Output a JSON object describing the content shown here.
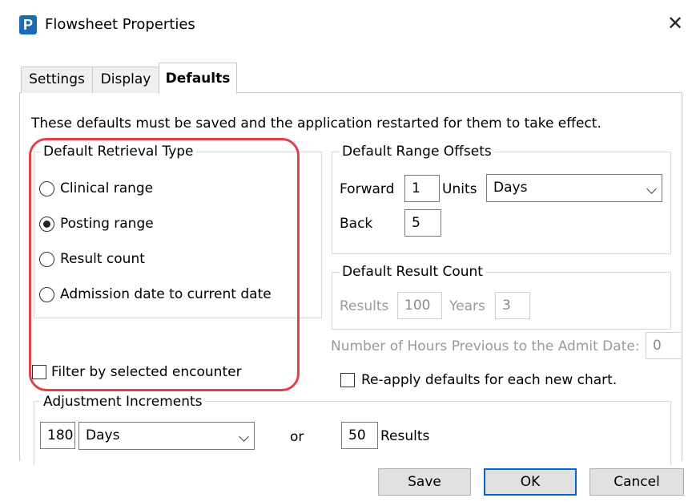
{
  "window": {
    "app_icon_letter": "P",
    "title": "Flowsheet Properties",
    "close_glyph": "✕"
  },
  "tabs": [
    {
      "label": "Settings",
      "active": false
    },
    {
      "label": "Display",
      "active": false
    },
    {
      "label": "Defaults",
      "active": true
    }
  ],
  "notice": "These defaults must be saved and the application restarted for them to take effect.",
  "retrieval": {
    "legend": "Default Retrieval Type",
    "options": [
      {
        "label": "Clinical range",
        "selected": false
      },
      {
        "label": "Posting range",
        "selected": true
      },
      {
        "label": "Result count",
        "selected": false
      },
      {
        "label": "Admission date to current date",
        "selected": false
      }
    ]
  },
  "filter_encounter": {
    "label": "Filter by selected encounter",
    "checked": false
  },
  "range_offsets": {
    "legend": "Default Range Offsets",
    "forward_label": "Forward",
    "forward_value": "1",
    "units_label": "Units",
    "units_value": "Days",
    "back_label": "Back",
    "back_value": "5"
  },
  "result_count": {
    "legend": "Default Result Count",
    "results_label": "Results",
    "results_value": "100",
    "years_label": "Years",
    "years_value": "3"
  },
  "hours_previous": {
    "label": "Number of Hours Previous to the Admit Date:",
    "value": "0"
  },
  "reapply": {
    "label": "Re-apply defaults for each new chart.",
    "checked": false
  },
  "adjustment": {
    "legend": "Adjustment Increments",
    "days_value": "180",
    "days_unit": "Days",
    "or_label": "or",
    "results_value": "50",
    "results_label": "Results"
  },
  "buttons": {
    "save": "Save",
    "ok": "OK",
    "cancel": "Cancel"
  },
  "colors": {
    "highlight": "#e0404a",
    "app_icon": "#1a6cb5",
    "default_button_border": "#0a64c8"
  }
}
